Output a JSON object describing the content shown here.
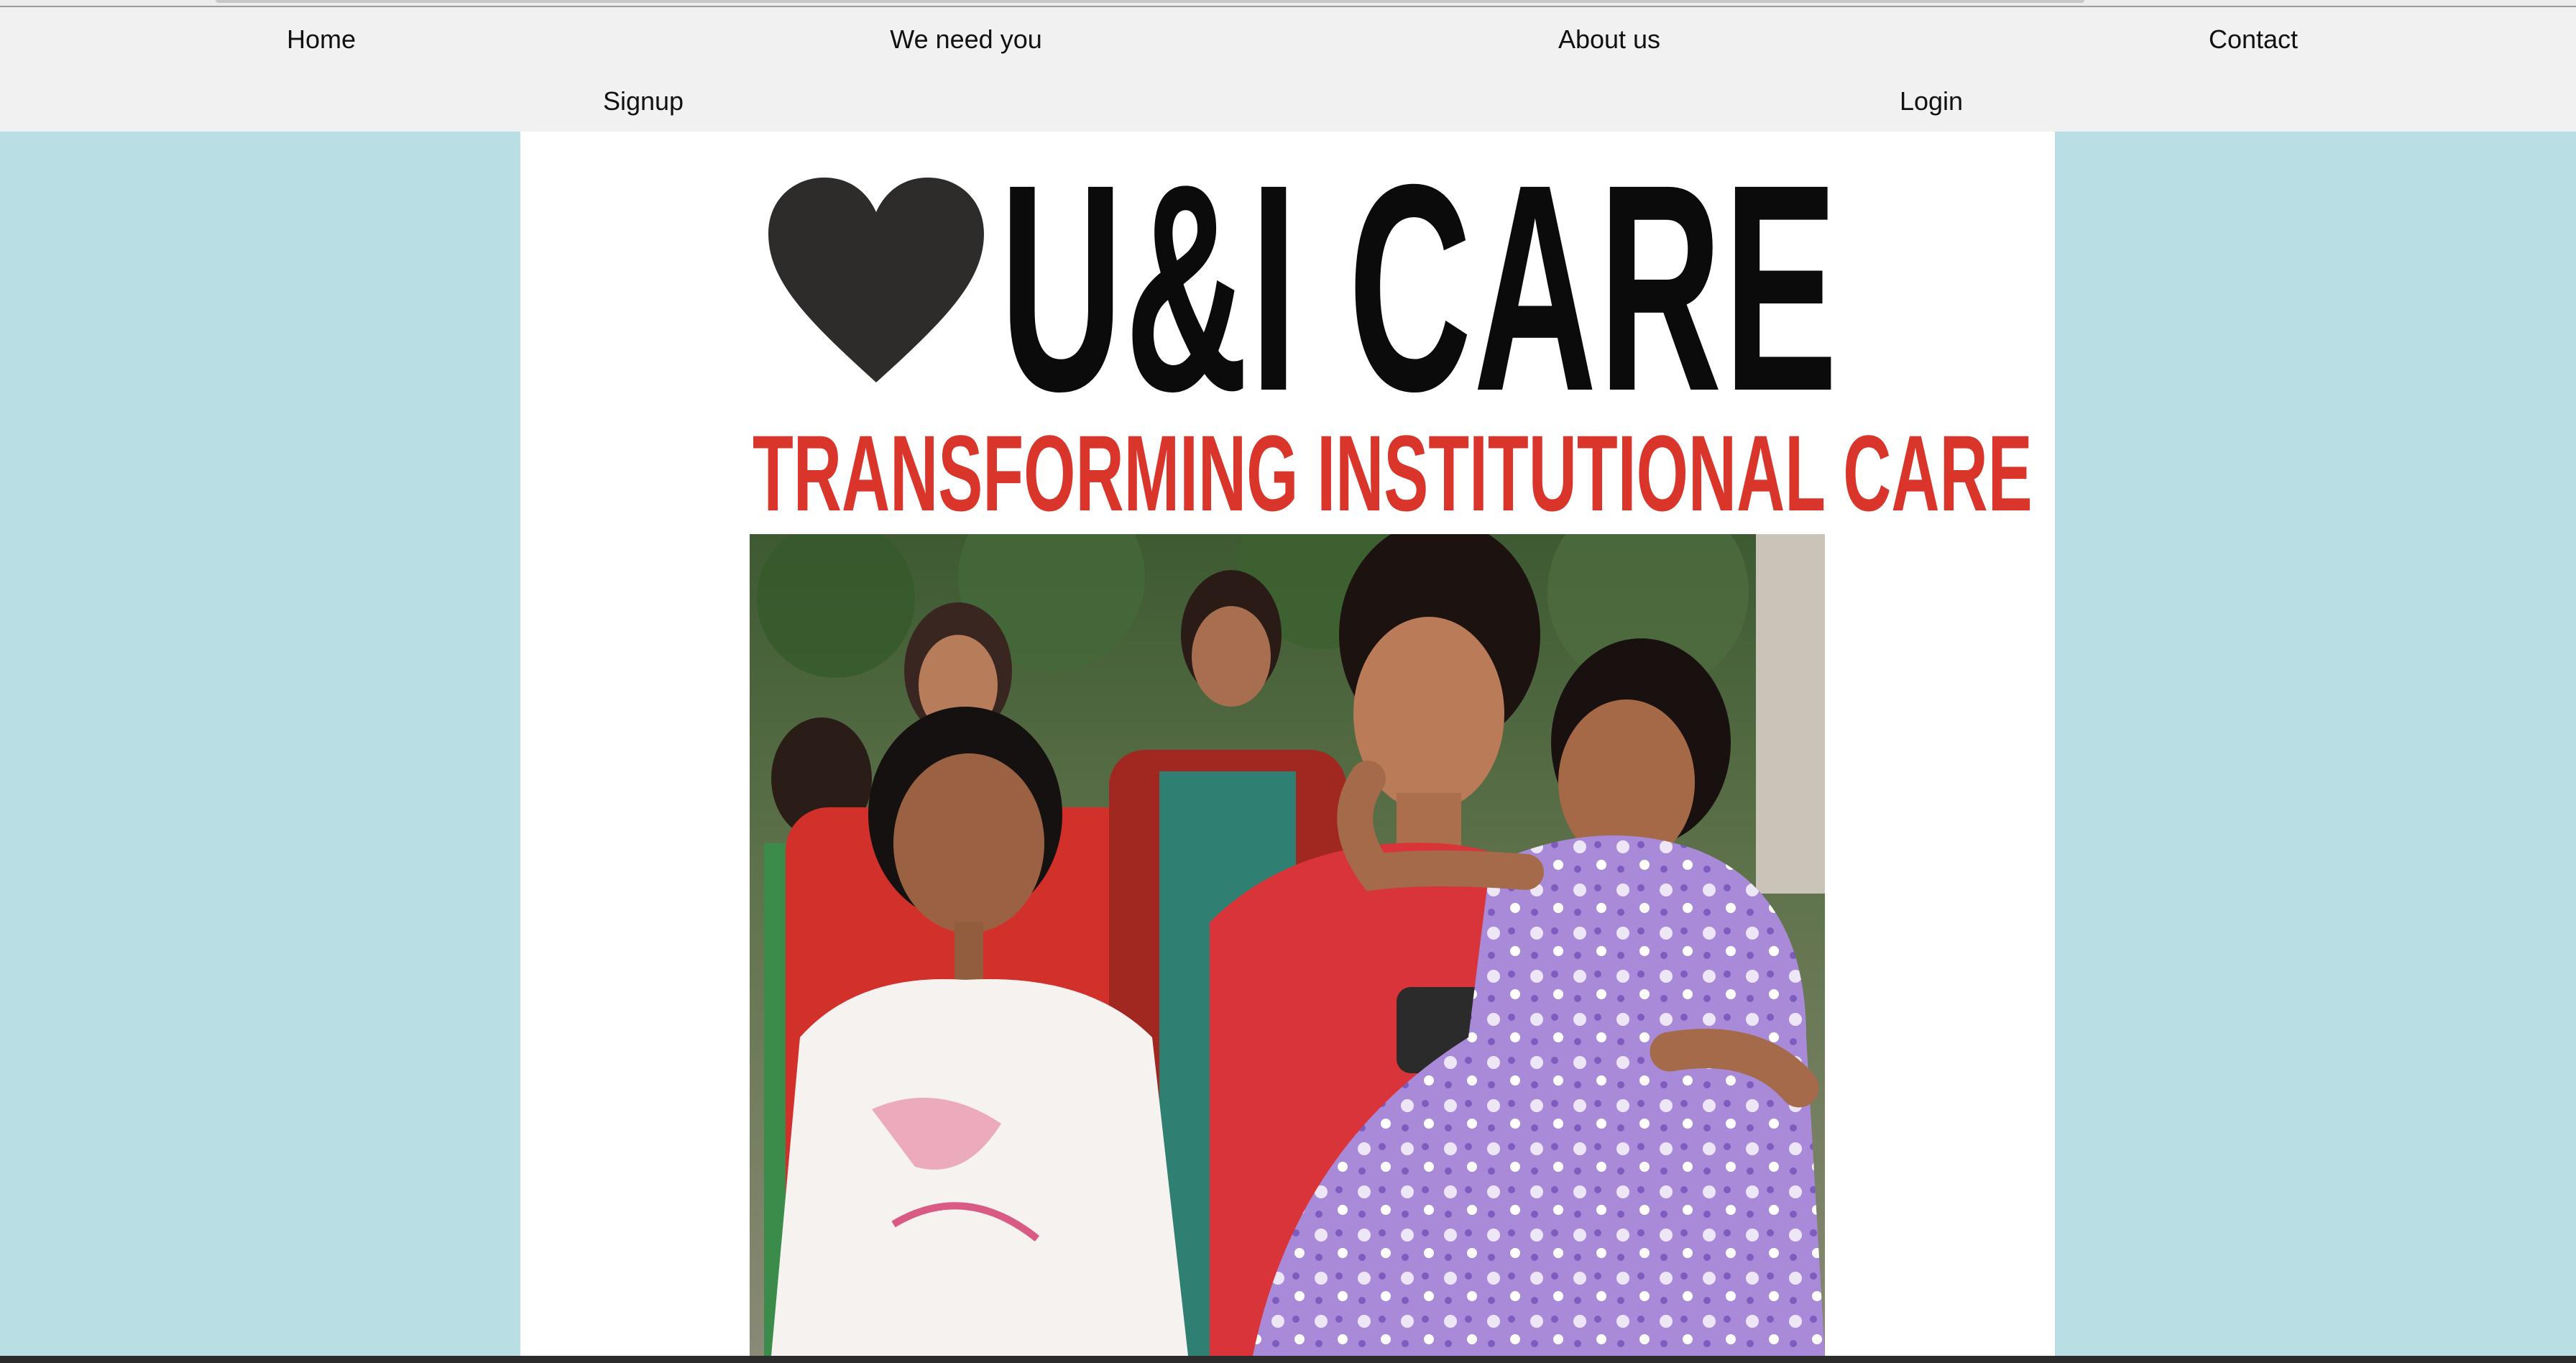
{
  "nav": {
    "row1": [
      "Home",
      "We need you",
      "About us",
      "Contact"
    ],
    "row2": [
      "Signup",
      "Login"
    ]
  },
  "hero": {
    "logo_text": "U&I CARE",
    "tagline": "TRANSFORMING INSTITUTIONAL CARE",
    "photo_alt": "Children and a volunteer walking together outdoors"
  },
  "colors": {
    "page_background": "#b9dfe4",
    "nav_background": "#f1f1f1",
    "content_background": "#ffffff",
    "logo_black": "#0b0b0b",
    "heart_color": "#2e2b2b",
    "tagline_red": "#d9352b"
  },
  "icons": {
    "logo_symbol": "heart-icon"
  }
}
